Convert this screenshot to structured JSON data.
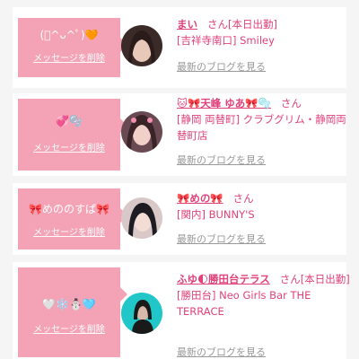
{
  "delete_label": "メッセージを削除",
  "blog_label": "最新のブログを見る",
  "san_label": "さん",
  "cards": [
    {
      "message": "(ﾟ^ᴗ^ﾟ)🧡",
      "name": "まい",
      "suffix": "[本日出勤]",
      "location": "[吉祥寺南口] Smiley"
    },
    {
      "message": "💞🫧",
      "name": "🐱🎀天峰 ゆあ🎀🫧",
      "suffix": "",
      "location": "[静岡 両替町] クラブグリム・静岡両替町店"
    },
    {
      "message": "🎀めののすぱ🎀",
      "name": "🎀めの🎀",
      "suffix": "",
      "location": "[関内] BUNNY'S"
    },
    {
      "message": "🤍❄️⛄🩵",
      "name": "ふゆ🌓勝田台テラス",
      "suffix": "[本日出勤]",
      "location": "[勝田台] Neo Girls Bar THE TERRACE"
    }
  ],
  "colors": {
    "accent": "#e0427a",
    "bubble": "#f4a3b6",
    "muted": "#999999"
  }
}
